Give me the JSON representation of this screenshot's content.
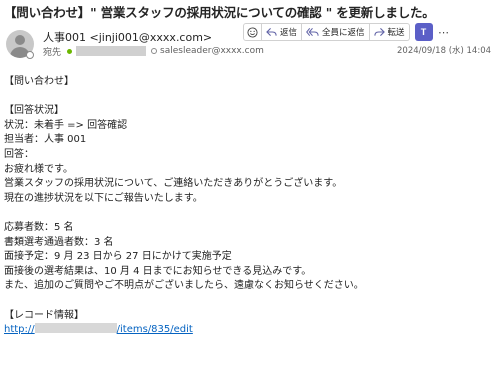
{
  "email": {
    "subject": "【問い合わせ】\" 営業スタッフの採用状況についての確認 \" を更新しました。",
    "sender": "人事001 <jinji001@xxxx.com>",
    "to_label": "宛先",
    "cc_address": "salesleader@xxxx.com",
    "date": "2024/09/18 (水) 14:04"
  },
  "toolbar": {
    "reply_label": "返信",
    "reply_all_label": "全員に返信",
    "forward_label": "転送",
    "teams_label": "T",
    "more_label": "⋯"
  },
  "body_lines": [
    "【問い合わせ】",
    "",
    "【回答状況】",
    "状況：未着手 => 回答確認",
    "担当者：人事 001",
    "回答：",
    "お疲れ様です。",
    "営業スタッフの採用状況について、ご連絡いただきありがとうございます。",
    "現在の進捗状況を以下にご報告いたします。",
    "",
    "応募者数：5 名",
    "書類選考通過者数：3 名",
    "面接予定：9 月 23 日から 27 日にかけて実施予定",
    "面接後の選考結果は、10 月 4 日までにお知らせできる見込みです。",
    "また、追加のご質問やご不明点がございましたら、遠慮なくお知らせください。",
    "",
    "【レコード情報】"
  ],
  "link": {
    "prefix": "http://",
    "suffix": "/items/835/edit"
  },
  "colors": {
    "accent": "#5b5fc7",
    "link": "#0563c1",
    "presence": "#6bb700"
  }
}
